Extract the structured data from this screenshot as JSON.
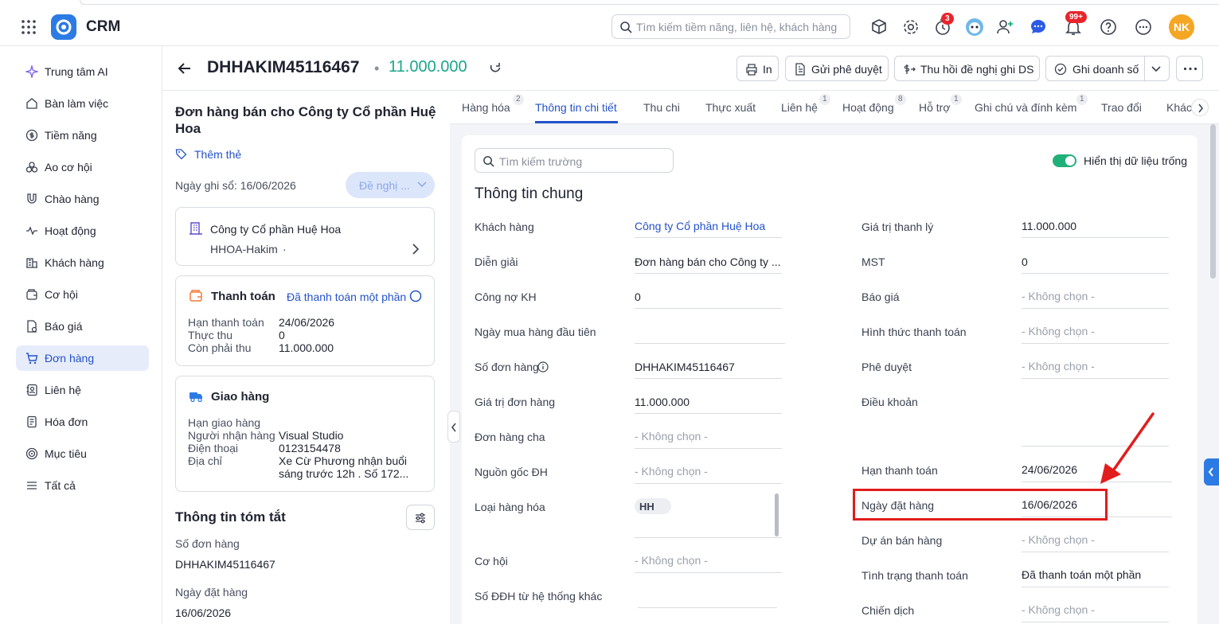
{
  "app": {
    "brand": "CRM"
  },
  "topbar": {
    "search_placeholder": "Tìm kiếm tiềm năng, liên hệ, khách hàng",
    "timer_badge": "3",
    "notification_badge": "99+",
    "avatar_initials": "NK"
  },
  "sidebar": {
    "items": [
      {
        "label": "Trung tâm AI",
        "icon": "sparkle-icon"
      },
      {
        "label": "Bàn làm việc",
        "icon": "home-icon"
      },
      {
        "label": "Tiềm năng",
        "icon": "dollar-circle-icon"
      },
      {
        "label": "Ao cơ hội",
        "icon": "pool-icon"
      },
      {
        "label": "Chào hàng",
        "icon": "magnet-icon"
      },
      {
        "label": "Hoạt động",
        "icon": "activity-icon"
      },
      {
        "label": "Khách hàng",
        "icon": "building-icon"
      },
      {
        "label": "Cơ hội",
        "icon": "wallet-icon"
      },
      {
        "label": "Báo giá",
        "icon": "quote-icon"
      },
      {
        "label": "Đơn hàng",
        "icon": "cart-icon"
      },
      {
        "label": "Liên hệ",
        "icon": "contact-icon"
      },
      {
        "label": "Hóa đơn",
        "icon": "invoice-icon"
      },
      {
        "label": "Mục tiêu",
        "icon": "target-icon"
      },
      {
        "label": "Tất cả",
        "icon": "menu-icon"
      }
    ],
    "active_index": 9
  },
  "header": {
    "order_code": "DHHAKIM45116467",
    "separator": "•",
    "order_value": "11.000.000",
    "buttons": {
      "print": "In",
      "send_approval": "Gửi phê duyệt",
      "revoke": "Thu hồi đề nghị ghi DS",
      "record_sales": "Ghi doanh số"
    }
  },
  "left": {
    "title": "Đơn hàng bán cho Công ty Cổ phần Huệ Hoa",
    "add_tag": "Thêm thẻ",
    "record_date": "Ngày ghi sổ: 16/06/2026",
    "propose_button": "Đề nghị ...",
    "customer_card": {
      "name": "Công ty Cổ phần Huệ Hoa",
      "code": "HHOA-Hakim",
      "code_suffix": "·"
    },
    "payment_card": {
      "title": "Thanh toán",
      "status": "Đã thanh toán một phần",
      "rows": [
        {
          "label": "Hạn thanh toán",
          "value": "24/06/2026"
        },
        {
          "label": "Thực thu",
          "value": "0"
        },
        {
          "label": "Còn phải thu",
          "value": "11.000.000"
        }
      ]
    },
    "delivery_card": {
      "title": "Giao hàng",
      "rows": [
        {
          "label": "Hạn giao hàng",
          "value": ""
        },
        {
          "label": "Người nhận hàng",
          "value": "Visual Studio"
        },
        {
          "label": "Điện thoại",
          "value": "0123154478"
        },
        {
          "label": "Địa chỉ",
          "value": "Xe Cừ Phương nhận buổi sáng trước 12h . Số 172..."
        }
      ]
    },
    "summary": {
      "title": "Thông tin tóm tắt",
      "items": [
        {
          "label": "Số đơn hàng",
          "value": "DHHAKIM45116467"
        },
        {
          "label": "Ngày đặt hàng",
          "value": "16/06/2026"
        }
      ]
    }
  },
  "tabs": [
    {
      "label": "Hàng hóa",
      "count": "2"
    },
    {
      "label": "Thông tin chi tiết",
      "count": ""
    },
    {
      "label": "Thu chi",
      "count": ""
    },
    {
      "label": "Thực xuất",
      "count": ""
    },
    {
      "label": "Liên hệ",
      "count": "1"
    },
    {
      "label": "Hoạt động",
      "count": "8"
    },
    {
      "label": "Hỗ trợ",
      "count": "1"
    },
    {
      "label": "Ghi chú và đính kèm",
      "count": "1"
    },
    {
      "label": "Trao đổi",
      "count": ""
    },
    {
      "label": "Khác",
      "count": ""
    }
  ],
  "detail": {
    "field_search_placeholder": "Tìm kiếm trường",
    "show_empty_label": "Hiển thị dữ liệu trống",
    "section_title": "Thông tin chung",
    "left_fields": [
      {
        "label": "Khách hàng",
        "value": "Công ty Cổ phần Huệ Hoa"
      },
      {
        "label": "Diễn giải",
        "value": "Đơn hàng bán cho Công ty ..."
      },
      {
        "label": "Công nợ KH",
        "value": "0"
      },
      {
        "label": "Ngày mua hàng đầu tiên",
        "value": ""
      },
      {
        "label": "Số đơn hàng",
        "value": "DHHAKIM45116467"
      },
      {
        "label": "Giá trị đơn hàng",
        "value": "11.000.000"
      },
      {
        "label": "Đơn hàng cha",
        "value": "- Không chọn -"
      },
      {
        "label": "Nguồn gốc ĐH",
        "value": "- Không chọn -"
      },
      {
        "label": "Loại hàng hóa",
        "value": "HH"
      },
      {
        "label": "Cơ hội",
        "value": "- Không chọn -"
      },
      {
        "label": "Số ĐĐH từ hệ thống khác",
        "value": ""
      }
    ],
    "right_fields": [
      {
        "label": "Giá trị thanh lý",
        "value": "11.000.000"
      },
      {
        "label": "MST",
        "value": "0"
      },
      {
        "label": "Báo giá",
        "value": "- Không chọn -"
      },
      {
        "label": "Hình thức thanh toán",
        "value": "- Không chọn -"
      },
      {
        "label": "Phê duyệt",
        "value": "- Không chọn -"
      },
      {
        "label": "Điều khoản",
        "value": ""
      },
      {
        "label": "Hạn thanh toán",
        "value": "24/06/2026"
      },
      {
        "label": "Ngày đặt hàng",
        "value": "16/06/2026"
      },
      {
        "label": "Dự án bán hàng",
        "value": "- Không chọn -"
      },
      {
        "label": "Tình trạng thanh toán",
        "value": "Đã thanh toán một phần"
      },
      {
        "label": "Chiến dịch",
        "value": "- Không chọn -"
      }
    ]
  },
  "colors": {
    "accent": "#2452c8",
    "value_green": "#1aa68a",
    "highlight_red": "#e11d1d",
    "badge_red": "#e8252b"
  }
}
